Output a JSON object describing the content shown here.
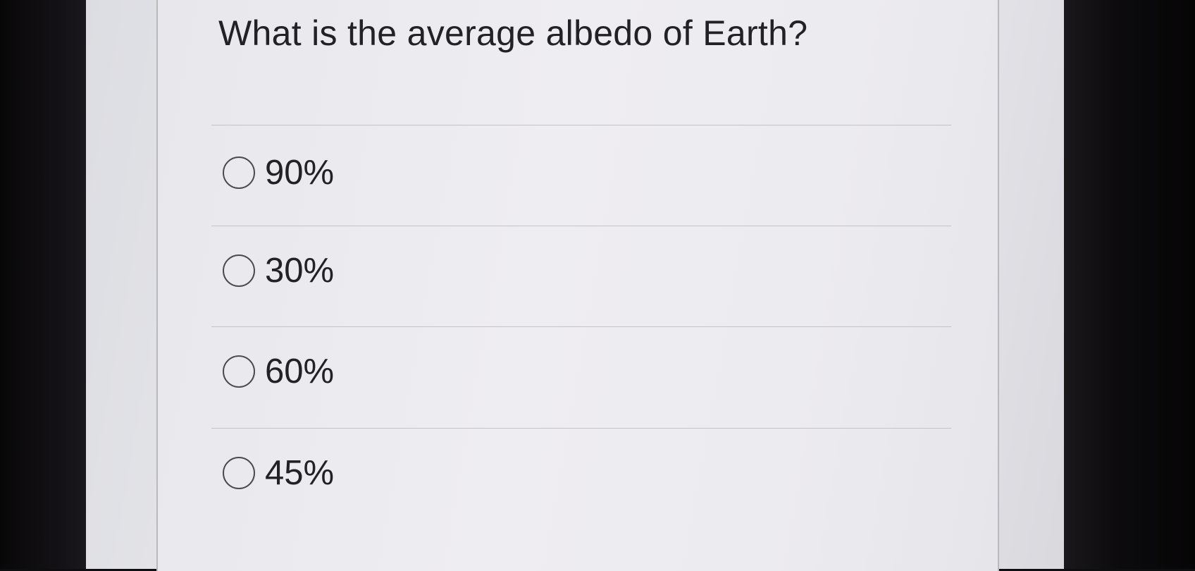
{
  "quiz": {
    "question": "What is the average albedo of Earth?",
    "options": [
      {
        "label": "90%",
        "selected": false
      },
      {
        "label": "30%",
        "selected": false
      },
      {
        "label": "60%",
        "selected": false
      },
      {
        "label": "45%",
        "selected": false
      }
    ]
  },
  "colors": {
    "background": "#e8e8ec",
    "text": "#222226",
    "radio_border": "#4a4a4f",
    "divider": "#c3c3c8"
  }
}
